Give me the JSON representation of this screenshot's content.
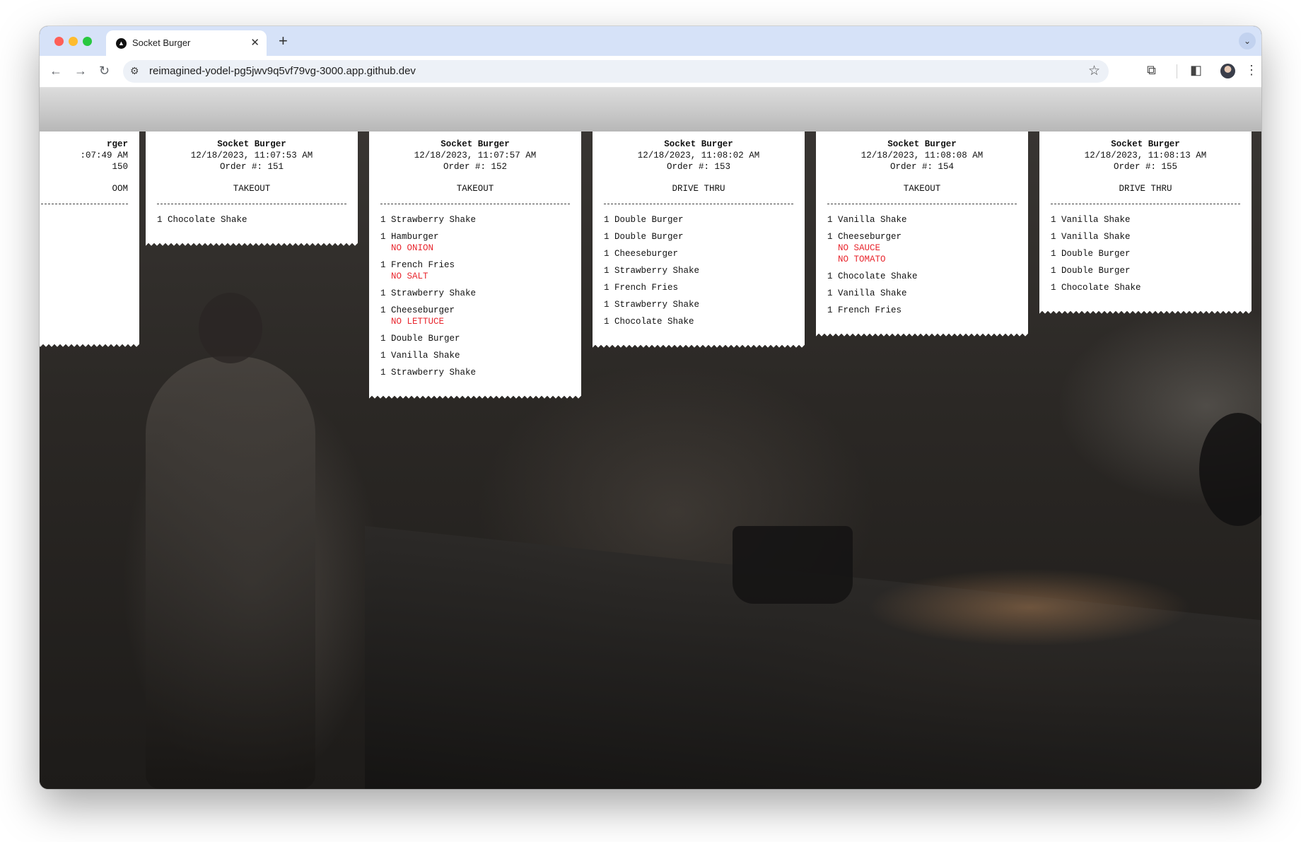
{
  "browser": {
    "tab_title": "Socket Burger",
    "tab_favicon_letter": "▲",
    "url": "reimagined-yodel-pg5jwv9q5vf79vg-3000.app.github.dev",
    "icons": [
      "back-icon",
      "forward-icon",
      "reload-icon",
      "site-settings-icon",
      "star-icon",
      "extensions-icon",
      "side-panel-icon",
      "menu-icon"
    ]
  },
  "colors": {
    "modifier_red": "#e8262e",
    "tab_strip": "#d6e2f8"
  },
  "tickets": [
    {
      "name": "rger",
      "datetime": ":07:49 AM",
      "order": "150",
      "type": "OOM",
      "items": []
    },
    {
      "name": "Socket Burger",
      "datetime": "12/18/2023, 11:07:53 AM",
      "order": "Order #: 151",
      "type": "TAKEOUT",
      "items": [
        {
          "text": "1 Chocolate Shake",
          "mods": []
        }
      ]
    },
    {
      "name": "Socket Burger",
      "datetime": "12/18/2023, 11:07:57 AM",
      "order": "Order #: 152",
      "type": "TAKEOUT",
      "items": [
        {
          "text": "1 Strawberry Shake",
          "mods": []
        },
        {
          "text": "1 Hamburger",
          "mods": [
            "NO ONION"
          ]
        },
        {
          "text": "1 French Fries",
          "mods": [
            "NO SALT"
          ]
        },
        {
          "text": "1 Strawberry Shake",
          "mods": []
        },
        {
          "text": "1 Cheeseburger",
          "mods": [
            "NO LETTUCE"
          ]
        },
        {
          "text": "1 Double Burger",
          "mods": []
        },
        {
          "text": "1 Vanilla Shake",
          "mods": []
        },
        {
          "text": "1 Strawberry Shake",
          "mods": []
        }
      ]
    },
    {
      "name": "Socket Burger",
      "datetime": "12/18/2023, 11:08:02 AM",
      "order": "Order #: 153",
      "type": "DRIVE THRU",
      "items": [
        {
          "text": "1 Double Burger",
          "mods": []
        },
        {
          "text": "1 Double Burger",
          "mods": []
        },
        {
          "text": "1 Cheeseburger",
          "mods": []
        },
        {
          "text": "1 Strawberry Shake",
          "mods": []
        },
        {
          "text": "1 French Fries",
          "mods": []
        },
        {
          "text": "1 Strawberry Shake",
          "mods": []
        },
        {
          "text": "1 Chocolate Shake",
          "mods": []
        }
      ]
    },
    {
      "name": "Socket Burger",
      "datetime": "12/18/2023, 11:08:08 AM",
      "order": "Order #: 154",
      "type": "TAKEOUT",
      "items": [
        {
          "text": "1 Vanilla Shake",
          "mods": []
        },
        {
          "text": "1 Cheeseburger",
          "mods": [
            "NO SAUCE",
            "NO TOMATO"
          ]
        },
        {
          "text": "1 Chocolate Shake",
          "mods": []
        },
        {
          "text": "1 Vanilla Shake",
          "mods": []
        },
        {
          "text": "1 French Fries",
          "mods": []
        }
      ]
    },
    {
      "name": "Socket Burger",
      "datetime": "12/18/2023, 11:08:13 AM",
      "order": "Order #: 155",
      "type": "DRIVE THRU",
      "items": [
        {
          "text": "1 Vanilla Shake",
          "mods": []
        },
        {
          "text": "1 Vanilla Shake",
          "mods": []
        },
        {
          "text": "1 Double Burger",
          "mods": []
        },
        {
          "text": "1 Double Burger",
          "mods": []
        },
        {
          "text": "1 Chocolate Shake",
          "mods": []
        }
      ]
    }
  ]
}
